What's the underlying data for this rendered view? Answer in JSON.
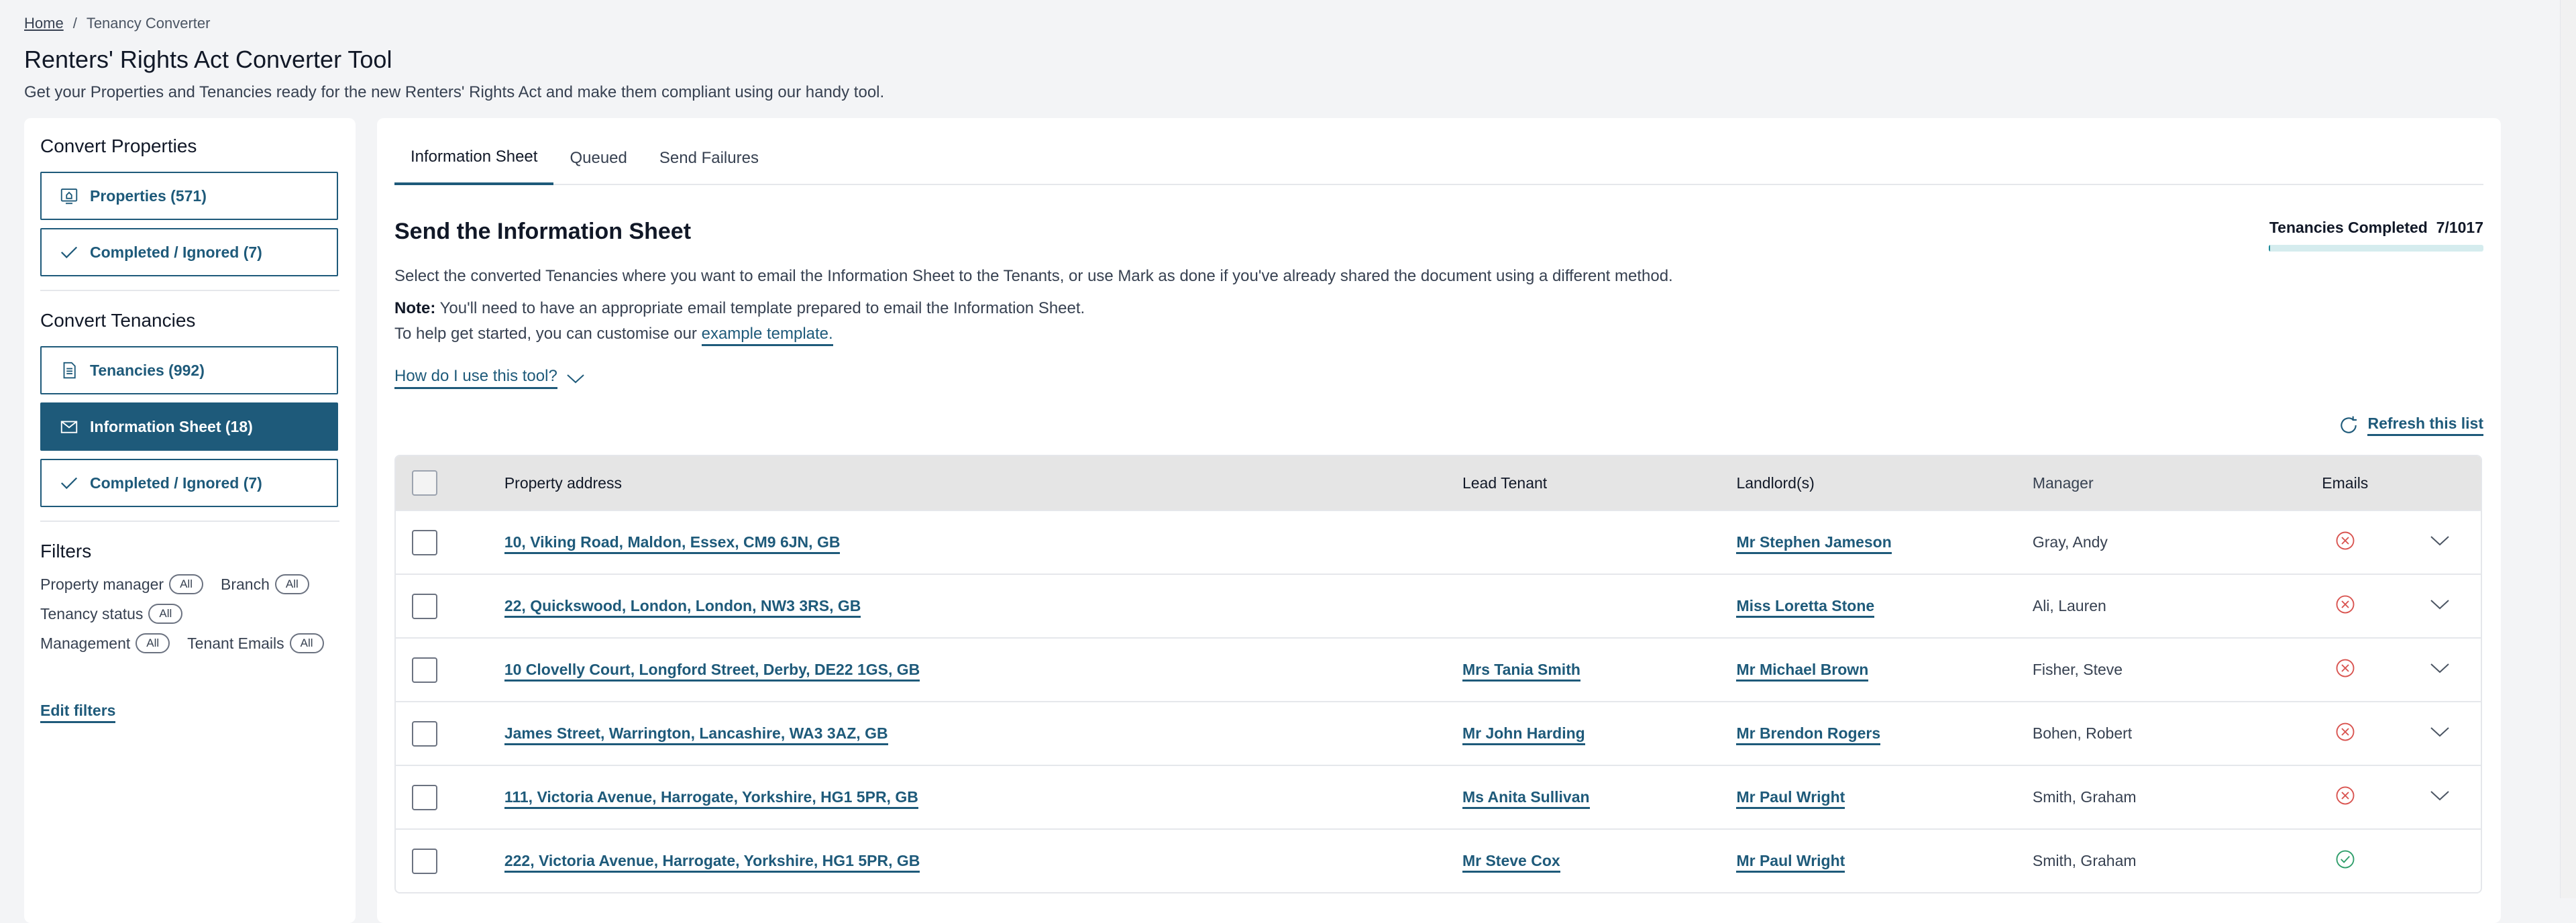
{
  "breadcrumb": {
    "home": "Home",
    "separator": "/",
    "current": "Tenancy Converter"
  },
  "page": {
    "title": "Renters' Rights Act Converter Tool",
    "subtitle": "Get your Properties and Tenancies ready for the new Renters' Rights Act and make them compliant using our handy tool."
  },
  "sidebar": {
    "convert_properties": {
      "heading": "Convert Properties",
      "properties": "Properties (571)",
      "completed": "Completed / Ignored (7)"
    },
    "convert_tenancies": {
      "heading": "Convert Tenancies",
      "tenancies": "Tenancies (992)",
      "information_sheet": "Information Sheet (18)",
      "completed": "Completed / Ignored (7)"
    },
    "filters": {
      "title": "Filters",
      "property_manager": "Property manager",
      "branch": "Branch",
      "tenancy_status": "Tenancy status",
      "management": "Management",
      "tenant_emails": "Tenant Emails",
      "all": "All",
      "edit": "Edit filters"
    }
  },
  "tabs": [
    "Information Sheet",
    "Queued",
    "Send Failures"
  ],
  "section": {
    "title": "Send the Information Sheet",
    "progress_label": "Tenancies Completed",
    "progress_value": "7/1017",
    "progress_fraction": 0.0069,
    "desc1": "Select the converted Tenancies where you want to email the Information Sheet to the Tenants, or use Mark as done if you've already shared the document using a different method.",
    "note_label": "Note:",
    "note_text": "You'll need to have an appropriate email template prepared to email the Information Sheet.",
    "help_prefix": "To help get started, you can customise our",
    "help_link": "example template.",
    "howto": "How do I use this tool?",
    "refresh": "Refresh this list"
  },
  "table": {
    "headers": {
      "address": "Property address",
      "tenant": "Lead Tenant",
      "landlord": "Landlord(s)",
      "manager": "Manager",
      "emails": "Emails"
    },
    "rows": [
      {
        "address": "10, Viking Road, Maldon, Essex, CM9 6JN, GB",
        "tenant": "",
        "landlord": "Mr Stephen Jameson",
        "manager": "Gray, Andy",
        "status": "failed"
      },
      {
        "address": "22, Quickswood, London, London, NW3 3RS, GB",
        "tenant": "",
        "landlord": "Miss Loretta Stone",
        "manager": "Ali, Lauren",
        "status": "failed"
      },
      {
        "address": "10 Clovelly Court, Longford Street, Derby, DE22 1GS, GB",
        "tenant": "Mrs Tania Smith",
        "landlord": "Mr Michael Brown",
        "manager": "Fisher, Steve",
        "status": "failed"
      },
      {
        "address": "James Street, Warrington, Lancashire, WA3 3AZ, GB",
        "tenant": "Mr John Harding",
        "landlord": "Mr Brendon Rogers",
        "manager": "Bohen, Robert",
        "status": "failed"
      },
      {
        "address": "111, Victoria Avenue, Harrogate, Yorkshire, HG1 5PR, GB",
        "tenant": "Ms Anita Sullivan",
        "landlord": "Mr Paul Wright",
        "manager": "Smith, Graham",
        "status": "failed"
      },
      {
        "address": "222, Victoria Avenue, Harrogate, Yorkshire, HG1 5PR, GB",
        "tenant": "Mr Steve Cox",
        "landlord": "Mr Paul Wright",
        "manager": "Smith, Graham",
        "status": "ok"
      }
    ]
  },
  "colors": {
    "primary": "#1e5a7a",
    "error": "#d9534f",
    "success": "#2e9e6a",
    "progress": "#1e8a9a"
  }
}
